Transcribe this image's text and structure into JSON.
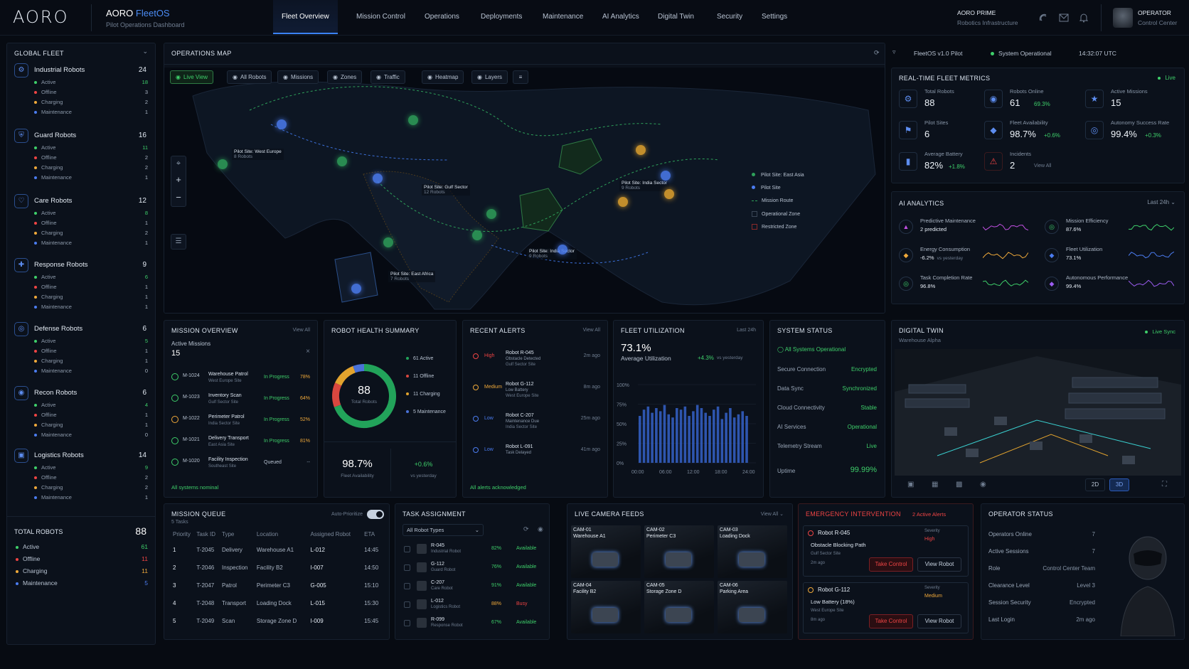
{
  "app": {
    "logo": "AORO",
    "brand": "AORO",
    "product": "FleetOS",
    "subtitle": "Pilot Operations Dashboard"
  },
  "nav": [
    "Fleet Overview",
    "Mission Control",
    "Operations",
    "Deployments",
    "Maintenance",
    "AI Analytics",
    "Digital Twin",
    "Security",
    "Settings"
  ],
  "org": {
    "name": "AORO PRIME",
    "sub": "Robotics Infrastructure"
  },
  "user": {
    "role": "OPERATOR",
    "name": "Control Center"
  },
  "fleet": {
    "title": "GLOBAL FLEET",
    "groups": [
      {
        "name": "Industrial Robots",
        "total": "24",
        "active": "18",
        "offline": "3",
        "charging": "2",
        "maintenance": "1"
      },
      {
        "name": "Guard Robots",
        "total": "16",
        "active": "11",
        "offline": "2",
        "charging": "2",
        "maintenance": "1"
      },
      {
        "name": "Care Robots",
        "total": "12",
        "active": "8",
        "offline": "1",
        "charging": "2",
        "maintenance": "1"
      },
      {
        "name": "Response Robots",
        "total": "9",
        "active": "6",
        "offline": "1",
        "charging": "1",
        "maintenance": "1"
      },
      {
        "name": "Defense Robots",
        "total": "6",
        "active": "5",
        "offline": "1",
        "charging": "1",
        "maintenance": "0"
      },
      {
        "name": "Recon Robots",
        "total": "6",
        "active": "4",
        "offline": "1",
        "charging": "1",
        "maintenance": "0"
      },
      {
        "name": "Logistics Robots",
        "total": "14",
        "active": "9",
        "offline": "2",
        "charging": "2",
        "maintenance": "1"
      }
    ],
    "status_labels": [
      "Active",
      "Offline",
      "Charging",
      "Maintenance"
    ],
    "total_label": "TOTAL ROBOTS",
    "total": "88",
    "totals": {
      "active": "61",
      "offline": "11",
      "charging": "11",
      "maintenance": "5"
    }
  },
  "map": {
    "title": "OPERATIONS MAP",
    "version": "FleetOS v1.0 Pilot",
    "status": "System Operational",
    "time": "14:32:07 UTC",
    "tabs": [
      "Live View",
      "All Robots",
      "Missions",
      "Zones",
      "Traffic",
      "Heatmap",
      "Layers"
    ],
    "sites": [
      {
        "name": "Pilot Site: West Europe",
        "robots": "8 Robots"
      },
      {
        "name": "Pilot Site: Gulf Sector",
        "robots": "12 Robots"
      },
      {
        "name": "Pilot Site: India Sector",
        "robots": "9 Robots"
      },
      {
        "name": "Pilot Site: India Sector",
        "robots": "9 Robots"
      },
      {
        "name": "Pilot Site: East Africa",
        "robots": "7 Robots"
      }
    ],
    "legend": [
      "Pilot Site: East Asia",
      "Pilot Site",
      "Mission Route",
      "Operational Zone",
      "Restricted Zone"
    ]
  },
  "metrics": {
    "title": "REAL-TIME FLEET METRICS",
    "live": "Live",
    "items": [
      {
        "label": "Total Robots",
        "value": "88",
        "delta": ""
      },
      {
        "label": "Robots Online",
        "value": "61",
        "delta": "69.3%"
      },
      {
        "label": "Active Missions",
        "value": "15",
        "delta": ""
      },
      {
        "label": "Pilot Sites",
        "value": "6",
        "delta": ""
      },
      {
        "label": "Fleet Availability",
        "value": "98.7%",
        "delta": "+0.6%"
      },
      {
        "label": "Autonomy Success Rate",
        "value": "99.4%",
        "delta": "+0.3%"
      },
      {
        "label": "Average Battery",
        "value": "82%",
        "delta": "+1.8%"
      },
      {
        "label": "Incidents",
        "value": "2",
        "delta": "View All"
      }
    ]
  },
  "ai": {
    "title": "AI ANALYTICS",
    "range": "Last 24h",
    "items": [
      {
        "label": "Predictive Maintenance",
        "value": "2 predicted",
        "color": "#c04fe0"
      },
      {
        "label": "Mission Efficiency",
        "value": "87.6%",
        "color": "#3ecf6a"
      },
      {
        "label": "Energy Consumption",
        "value": "-6.2%",
        "extra": "vs yesterday",
        "color": "#f0a93a"
      },
      {
        "label": "Fleet Utilization",
        "value": "73.1%",
        "color": "#4b7cf0"
      },
      {
        "label": "Task Completion Rate",
        "value": "96.8%",
        "color": "#3ecf6a"
      },
      {
        "label": "Autonomous Performance",
        "value": "99.4%",
        "color": "#9b5cf0"
      }
    ]
  },
  "missions": {
    "title": "MISSION OVERVIEW",
    "view_all": "View All",
    "active_label": "Active Missions",
    "active": "15",
    "footer": "All systems nominal",
    "items": [
      {
        "id": "M-1024",
        "name": "Warehouse Patrol",
        "site": "West Europe Site",
        "status": "In Progress",
        "pct": "78%"
      },
      {
        "id": "M-1023",
        "name": "Inventory Scan",
        "site": "Gulf Sector Site",
        "status": "In Progress",
        "pct": "64%"
      },
      {
        "id": "M-1022",
        "name": "Perimeter Patrol",
        "site": "India Sector Site",
        "status": "In Progress",
        "pct": "52%"
      },
      {
        "id": "M-1021",
        "name": "Delivery Transport",
        "site": "East Asia Site",
        "status": "In Progress",
        "pct": "81%"
      },
      {
        "id": "M-1020",
        "name": "Facility Inspection",
        "site": "Southeast Site",
        "status": "Queued",
        "pct": "--"
      }
    ]
  },
  "health": {
    "title": "ROBOT HEALTH SUMMARY",
    "total": "88",
    "total_label": "Total Robots",
    "availability": "98.7%",
    "availability_label": "Fleet Availability",
    "delta": "+0.6%",
    "delta_label": "vs yesterday",
    "legend": [
      {
        "label": "61 Active",
        "value": 61,
        "color": "#22a35a"
      },
      {
        "label": "11 Offline",
        "value": 11,
        "color": "#d9473f"
      },
      {
        "label": "11 Charging",
        "value": 11,
        "color": "#e2a32e"
      },
      {
        "label": "5 Maintenance",
        "value": 5,
        "color": "#4a72d8"
      }
    ]
  },
  "alerts": {
    "title": "RECENT ALERTS",
    "view_all": "View All",
    "footer": "All alerts acknowledged",
    "items": [
      {
        "level": "High",
        "robot": "Robot R-045",
        "desc": "Obstacle Detected",
        "site": "Gulf Sector Site",
        "time": "2m ago"
      },
      {
        "level": "Medium",
        "robot": "Robot G-112",
        "desc": "Low Battery",
        "site": "West Europe Site",
        "time": "8m ago"
      },
      {
        "level": "Low",
        "robot": "Robot C-207",
        "desc": "Maintenance Due",
        "site": "India Sector Site",
        "time": "25m ago"
      },
      {
        "level": "Low",
        "robot": "Robot L-091",
        "desc": "Task Delayed",
        "site": "",
        "time": "41m ago"
      }
    ]
  },
  "utilization": {
    "title": "FLEET UTILIZATION",
    "range": "Last 24h",
    "value": "73.1%",
    "label": "Average Utilization",
    "delta": "+4.3%",
    "delta_label": "vs yesterday"
  },
  "chart_data": {
    "type": "bar",
    "x_ticks": [
      "00:00",
      "06:00",
      "12:00",
      "18:00",
      "24:00"
    ],
    "y_ticks": [
      "100%",
      "75%",
      "50%",
      "25%",
      "0%"
    ],
    "ylim": [
      0,
      100
    ],
    "values": [
      60,
      68,
      72,
      64,
      70,
      66,
      74,
      62,
      58,
      70,
      68,
      72,
      60,
      66,
      74,
      70,
      64,
      60,
      68,
      72,
      56,
      64,
      70,
      58,
      62,
      66,
      60
    ]
  },
  "system": {
    "title": "SYSTEM STATUS",
    "ok": "All Systems Operational",
    "items": [
      {
        "label": "Secure Connection",
        "value": "Encrypted"
      },
      {
        "label": "Data Sync",
        "value": "Synchronized"
      },
      {
        "label": "Cloud Connectivity",
        "value": "Stable"
      },
      {
        "label": "AI Services",
        "value": "Operational"
      },
      {
        "label": "Telemetry Stream",
        "value": "Live"
      },
      {
        "label": "Uptime",
        "value": "99.99%"
      }
    ]
  },
  "twin": {
    "title": "DIGITAL TWIN",
    "sub": "Warehouse Alpha",
    "live": "Live Sync",
    "mode2d": "2D",
    "mode3d": "3D"
  },
  "queue": {
    "title": "MISSION QUEUE",
    "sub": "5 Tasks",
    "auto": "Auto-Prioritize",
    "headers": [
      "Priority",
      "Task ID",
      "Type",
      "Location",
      "Assigned Robot",
      "ETA"
    ],
    "rows": [
      [
        "1",
        "T-2045",
        "Delivery",
        "Warehouse A1",
        "L-012",
        "14:45"
      ],
      [
        "2",
        "T-2046",
        "Inspection",
        "Facility B2",
        "I-007",
        "14:50"
      ],
      [
        "3",
        "T-2047",
        "Patrol",
        "Perimeter C3",
        "G-005",
        "15:10"
      ],
      [
        "4",
        "T-2048",
        "Transport",
        "Loading Dock",
        "L-015",
        "15:30"
      ],
      [
        "5",
        "T-2049",
        "Scan",
        "Storage Zone D",
        "I-009",
        "15:45"
      ]
    ]
  },
  "tasks": {
    "title": "TASK ASSIGNMENT",
    "filter": "All Robot Types",
    "rows": [
      {
        "id": "R-045",
        "type": "Industrial Robot",
        "pct": "82%",
        "status": "Available"
      },
      {
        "id": "G-112",
        "type": "Guard Robot",
        "pct": "76%",
        "status": "Available"
      },
      {
        "id": "C-207",
        "type": "Care Robot",
        "pct": "91%",
        "status": "Available"
      },
      {
        "id": "L-012",
        "type": "Logistics Robot",
        "pct": "88%",
        "status": "Busy"
      },
      {
        "id": "R-099",
        "type": "Response Robot",
        "pct": "67%",
        "status": "Available"
      }
    ]
  },
  "cameras": {
    "title": "LIVE CAMERA FEEDS",
    "view_all": "View All",
    "feeds": [
      {
        "id": "CAM-01",
        "loc": "Warehouse A1"
      },
      {
        "id": "CAM-02",
        "loc": "Perimeter C3"
      },
      {
        "id": "CAM-03",
        "loc": "Loading Dock"
      },
      {
        "id": "CAM-04",
        "loc": "Facility B2"
      },
      {
        "id": "CAM-05",
        "loc": "Storage Zone D"
      },
      {
        "id": "CAM-06",
        "loc": "Parking Area"
      }
    ]
  },
  "emergency": {
    "title": "EMERGENCY INTERVENTION",
    "count": "2 Active Alerts",
    "severity_label": "Severity",
    "take": "Take Control",
    "view": "View Robot",
    "items": [
      {
        "robot": "Robot R-045",
        "desc": "Obstacle Blocking Path",
        "site": "Gulf Sector Site",
        "time": "2m ago",
        "severity": "High"
      },
      {
        "robot": "Robot G-112",
        "desc": "Low Battery (18%)",
        "site": "West Europe Site",
        "time": "8m ago",
        "severity": "Medium"
      }
    ]
  },
  "operator": {
    "title": "OPERATOR STATUS",
    "items": [
      {
        "label": "Operators Online",
        "value": "7"
      },
      {
        "label": "Active Sessions",
        "value": "7"
      },
      {
        "label": "Role",
        "value": "Control Center Team"
      },
      {
        "label": "Clearance Level",
        "value": "Level 3"
      },
      {
        "label": "Session Security",
        "value": "Encrypted"
      },
      {
        "label": "Last Login",
        "value": "2m ago"
      }
    ]
  }
}
